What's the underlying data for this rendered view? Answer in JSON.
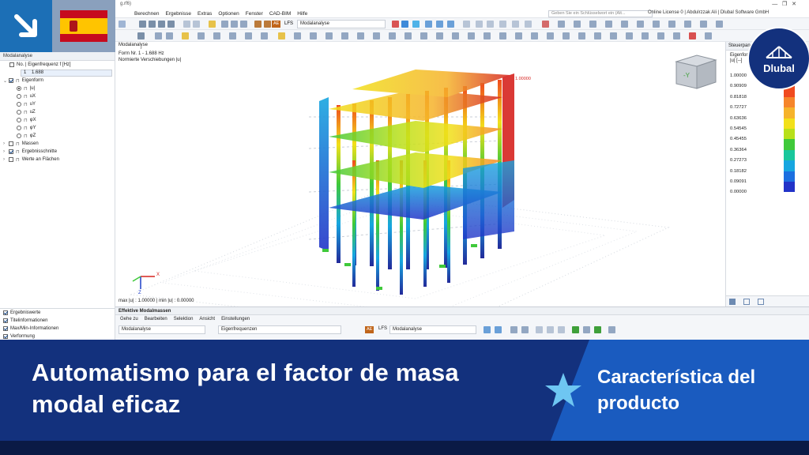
{
  "window": {
    "title_fragment": "g.rf6)"
  },
  "menubar": {
    "items": [
      "Berechnen",
      "Ergebnisse",
      "Extras",
      "Optionen",
      "Fenster",
      "CAD-BIM",
      "Hilfe"
    ],
    "search_placeholder": "Geben Sie ein Schlüsselwort ein (Alt...",
    "license": "Online License 0 | Abdulrzzak Ali | Dlubal Software GmbH"
  },
  "toolbar": {
    "tag_ae": "AE",
    "tag_lfs": "LFS",
    "analysis_select": "Modalanalyse"
  },
  "navigator": {
    "header": "Modalanalyse",
    "freq_label": "No. | Eigenfrequenz f [Hz]",
    "freq_no": "1",
    "freq_value": "1.688",
    "items": [
      {
        "label": "Eigenform",
        "type": "checkbox",
        "checked": true,
        "indent": 1
      },
      {
        "label": "|u|",
        "type": "radio",
        "checked": true,
        "indent": 2
      },
      {
        "label": "uX",
        "type": "radio",
        "checked": false,
        "indent": 2
      },
      {
        "label": "uY",
        "type": "radio",
        "checked": false,
        "indent": 2
      },
      {
        "label": "uZ",
        "type": "radio",
        "checked": false,
        "indent": 2
      },
      {
        "label": "φX",
        "type": "radio",
        "checked": false,
        "indent": 2
      },
      {
        "label": "φY",
        "type": "radio",
        "checked": false,
        "indent": 2
      },
      {
        "label": "φZ",
        "type": "radio",
        "checked": false,
        "indent": 2
      },
      {
        "label": "Massen",
        "type": "checkbox",
        "checked": false,
        "indent": 1
      },
      {
        "label": "Ergebnisschnitte",
        "type": "checkbox",
        "checked": true,
        "indent": 1
      },
      {
        "label": "Werte an Flächen",
        "type": "checkbox",
        "checked": false,
        "indent": 1
      }
    ],
    "bottom_items": [
      "Ergebniswerte",
      "Titelinformationen",
      "Max/Min-Informationen",
      "Verformung"
    ]
  },
  "viewport": {
    "info_lines": [
      "Modalanalyse",
      "Form Nr. 1 - 1.688 Hz",
      "Normierte Verschiebungen |u|"
    ],
    "info_title": "Modalanalyse",
    "footer": "max |u| : 1.00000 | min |u| : 0.00000",
    "max_label": "1.00000",
    "axis_x": "X",
    "axis_z": "Z"
  },
  "panel": {
    "header": "Steuerpan",
    "legend_title_1": "Eigenform",
    "legend_title_2": "|u| [--]",
    "legend_values": [
      "1.00000",
      "0.90909",
      "0.81818",
      "0.72727",
      "0.63636",
      "0.54545",
      "0.45455",
      "0.36364",
      "0.27273",
      "0.18182",
      "0.09091",
      "0.00000"
    ],
    "legend_colors": [
      "#d6231f",
      "#f04a1e",
      "#f6852a",
      "#f6b32b",
      "#f2e01a",
      "#b8e01a",
      "#3fc93a",
      "#19c79c",
      "#17a6e0",
      "#1c6fe0",
      "#2233c8",
      "#222a9a"
    ]
  },
  "table_panel": {
    "title": "Effektive Modalmassen",
    "menu": [
      "Gehe zu",
      "Bearbeiten",
      "Selektion",
      "Ansicht",
      "Einstellungen"
    ],
    "select_1": "Modalanalyse",
    "select_2": "Eigenfrequenzen",
    "select_3": "Modalanalyse",
    "tag_ae": "AE",
    "tag_lfs": "LFS"
  },
  "banner": {
    "headline": "Automatismo para el factor de masa modal eficaz",
    "feature": "Característica del producto"
  },
  "logo": {
    "text": "Dlubal"
  },
  "colors": {
    "banner_dark": "#13317d",
    "banner_accent": "#1a5bbf",
    "brand_blue": "#1c6fb6"
  }
}
